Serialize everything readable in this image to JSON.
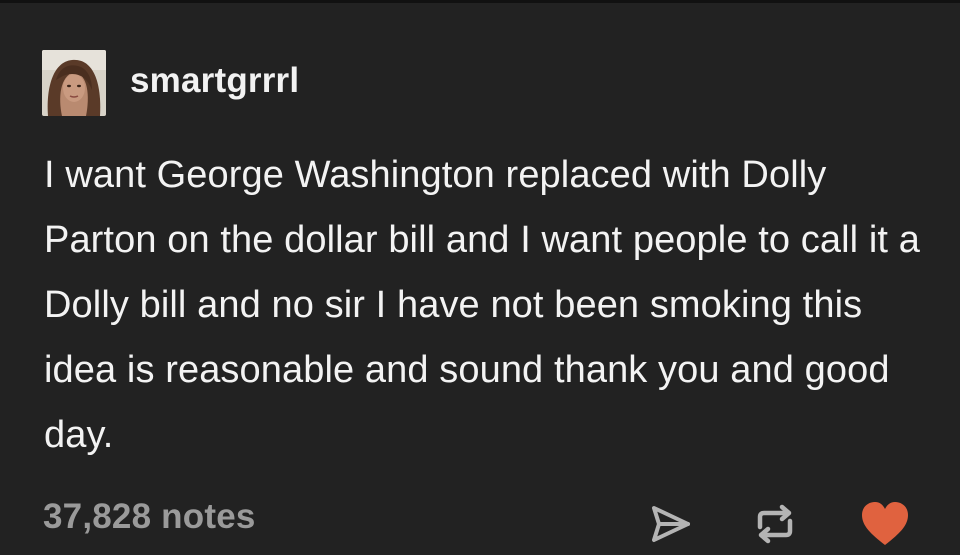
{
  "post": {
    "username": "smartgrrrl",
    "body": "I want George Washington replaced with Dolly Parton on the dollar bill and I want people to call it a Dolly bill and no sir I have not been smoking this idea is reasonable and sound thank you and good day.",
    "notes": "37,828 notes"
  },
  "icons": {
    "share": "share-icon",
    "reblog": "reblog-icon",
    "like": "heart-icon"
  },
  "colors": {
    "background": "#222222",
    "text": "#f3f3f3",
    "notes": "#9a9a9a",
    "heart": "#e0623f"
  }
}
